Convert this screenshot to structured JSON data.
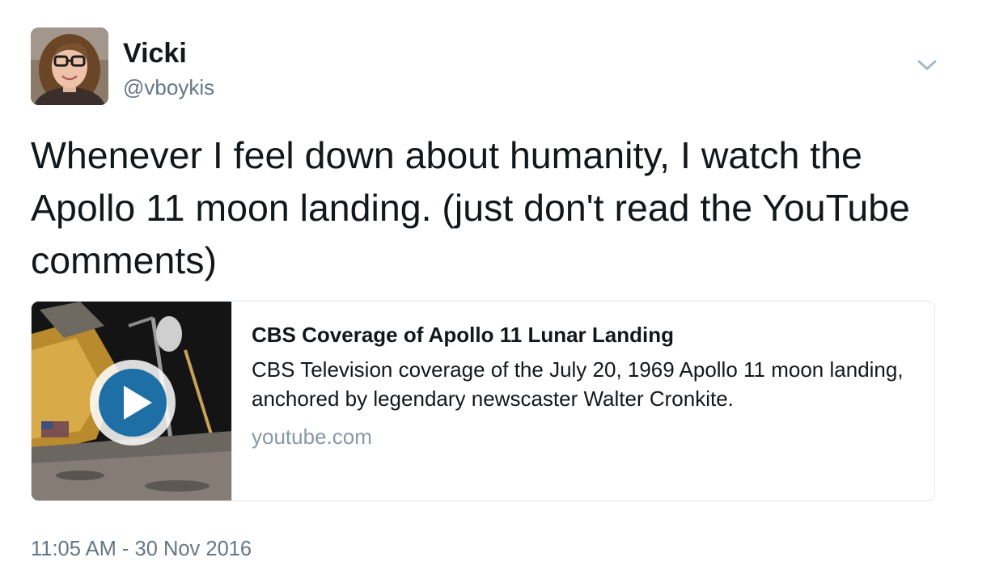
{
  "user": {
    "display_name": "Vicki",
    "handle": "@vboykis"
  },
  "tweet": {
    "text": "Whenever I feel down about humanity, I watch the Apollo 11 moon landing. (just don't read the YouTube comments)",
    "timestamp": "11:05 AM - 30 Nov 2016"
  },
  "card": {
    "title": "CBS Coverage of Apollo 11 Lunar Landing",
    "description": "CBS Television coverage of the July 20, 1969 Apollo 11 moon landing, anchored by legendary newscaster Walter Cronkite.",
    "domain": "youtube.com",
    "thumbnail_icon": "play-icon"
  },
  "icons": {
    "menu": "chevron-down-icon",
    "play": "play-icon"
  },
  "colors": {
    "text_primary": "#14171a",
    "text_secondary": "#657786",
    "domain_gray": "#8899a6",
    "play_blue": "#1d6fa5",
    "border": "#e1e8ed"
  }
}
